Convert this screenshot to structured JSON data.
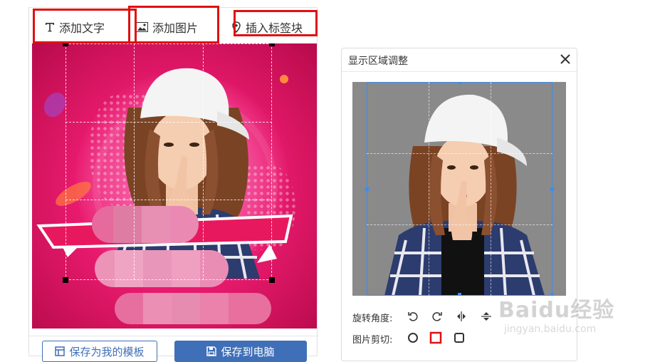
{
  "toolbar": {
    "add_text": "添加文字",
    "add_image": "添加图片",
    "insert_tag": "插入标签块"
  },
  "canvas": {
    "background_accent": "#e81a6e"
  },
  "actions": {
    "save_template": "保存为我的模板",
    "save_to_pc": "保存到电脑"
  },
  "dialog": {
    "title": "显示区域调整",
    "rotate_label": "旋转角度:",
    "crop_label": "图片剪切:",
    "crop_selected": "square",
    "accent": "#3b8cf0"
  },
  "watermark": {
    "brand": "Baidu经验",
    "url": "jingyan.baidu.com"
  },
  "colors": {
    "highlight_box": "#e01010",
    "primary_button": "#3f6fb7"
  }
}
